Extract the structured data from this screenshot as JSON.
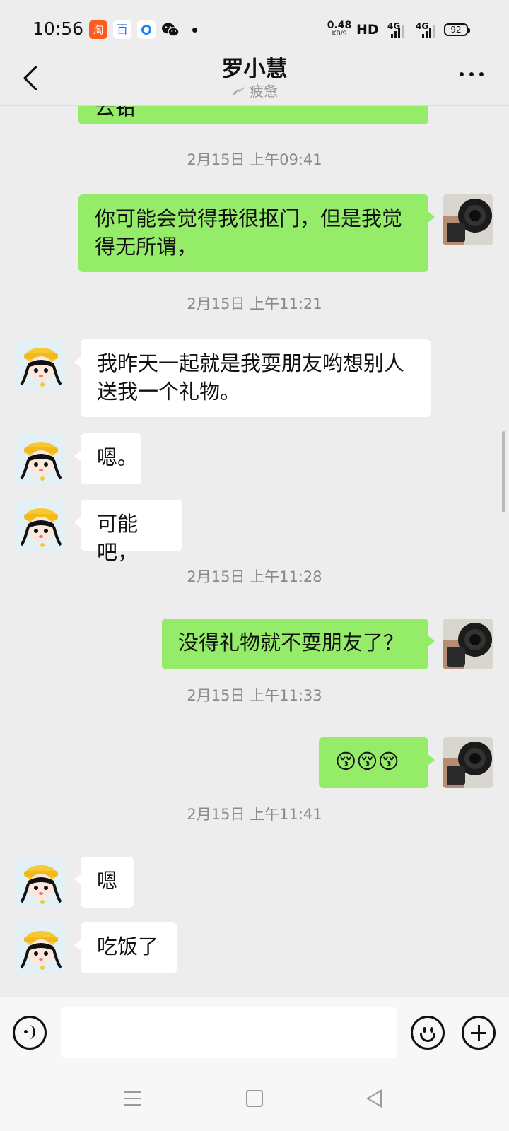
{
  "status_bar": {
    "time": "10:56",
    "taobao_icon": "taobao-app-icon",
    "taobao_glyph": "淘",
    "baidu_glyph": "百",
    "net_speed": "0.48",
    "net_speed_unit": "KB/S",
    "hd": "HD",
    "signal_1": "4G",
    "signal_2": "4G",
    "battery": "92"
  },
  "header": {
    "title": "罗小慧",
    "status": "疲惫"
  },
  "messages": {
    "partial_top": "云铅",
    "ts1": "2月15日 上午09:41",
    "m1": "你可能会觉得我很抠门，但是我觉得无所谓，",
    "ts2": "2月15日 上午11:21",
    "m2": "我昨天一起就是我耍朋友哟想别人送我一个礼物。",
    "m3": "嗯。",
    "m4": "可能吧，",
    "ts3": "2月15日 上午11:28",
    "m5": "没得礼物就不耍朋友了？",
    "ts4": "2月15日 上午11:33",
    "m6": "😚😚😚",
    "ts5": "2月15日 上午11:41",
    "m7": "嗯",
    "m8": "吃饭了"
  },
  "input_bar": {
    "placeholder": ""
  },
  "colors": {
    "outgoing_bubble": "#95ec69",
    "incoming_bubble": "#ffffff",
    "background": "#ededed"
  }
}
